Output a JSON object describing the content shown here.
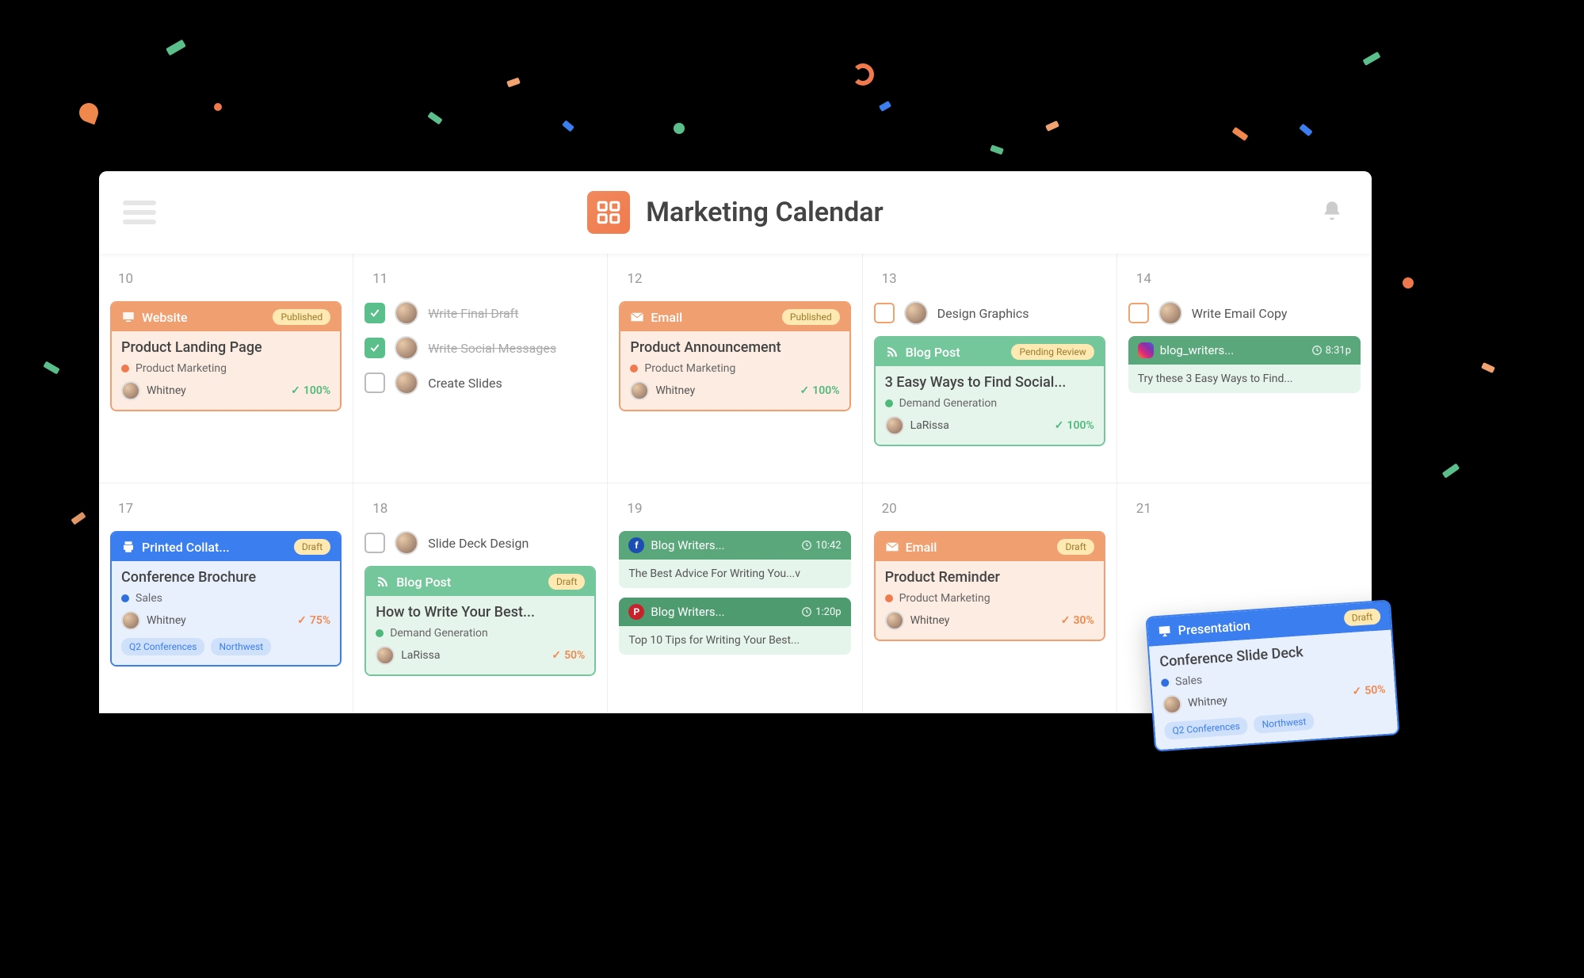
{
  "header": {
    "title": "Marketing Calendar"
  },
  "days": [
    {
      "num": "10",
      "cards": [
        {
          "variant": "orange",
          "iconType": "monitor",
          "type": "Website",
          "status": "Published",
          "title": "Product Landing Page",
          "categoryDot": "orange",
          "category": "Product Marketing",
          "assignee": "Whitney",
          "progressColor": "green",
          "progress": "100%"
        }
      ],
      "tasks": []
    },
    {
      "num": "11",
      "cards": [],
      "tasks": [
        {
          "state": "done",
          "label": "Write Final Draft",
          "strike": true
        },
        {
          "state": "done",
          "label": "Write Social Messages",
          "strike": true
        },
        {
          "state": "open",
          "label": "Create Slides",
          "strike": false
        }
      ]
    },
    {
      "num": "12",
      "cards": [
        {
          "variant": "orange",
          "iconType": "mail",
          "type": "Email",
          "status": "Published",
          "title": "Product Announcement",
          "categoryDot": "orange",
          "category": "Product Marketing",
          "assignee": "Whitney",
          "progressColor": "green",
          "progress": "100%"
        }
      ],
      "tasks": []
    },
    {
      "num": "13",
      "cards": [
        {
          "variant": "green",
          "iconType": "rss",
          "type": "Blog Post",
          "status": "Pending Review",
          "title": "3 Easy Ways to Find Social...",
          "categoryDot": "green",
          "category": "Demand Generation",
          "assignee": "LaRissa",
          "progressColor": "green",
          "progress": "100%"
        }
      ],
      "tasks": [
        {
          "state": "open-orange",
          "label": "Design Graphics",
          "strike": false
        }
      ]
    },
    {
      "num": "14",
      "social": [
        {
          "variant": "green",
          "network": "insta",
          "title": "blog_writers...",
          "time": "8:31p",
          "body": "Try these 3 Easy Ways to Find..."
        }
      ],
      "tasks": [
        {
          "state": "open-orange",
          "label": "Write Email Copy",
          "strike": false
        }
      ]
    },
    {
      "num": "17",
      "cards": [
        {
          "variant": "blue",
          "iconType": "print",
          "type": "Printed Collat...",
          "status": "Draft",
          "title": "Conference Brochure",
          "categoryDot": "blue",
          "category": "Sales",
          "assignee": "Whitney",
          "progressColor": "orange",
          "progress": "75%",
          "tags": [
            "Q2 Conferences",
            "Northwest"
          ]
        }
      ],
      "tasks": []
    },
    {
      "num": "18",
      "cards": [
        {
          "variant": "green",
          "iconType": "rss",
          "type": "Blog Post",
          "status": "Draft",
          "title": "How to Write Your Best...",
          "categoryDot": "green",
          "category": "Demand Generation",
          "assignee": "LaRissa",
          "progressColor": "orange",
          "progress": "50%"
        }
      ],
      "tasks": [
        {
          "state": "open",
          "label": "Slide Deck Design",
          "strike": false
        }
      ]
    },
    {
      "num": "19",
      "social": [
        {
          "variant": "green",
          "network": "fb",
          "title": "Blog Writers...",
          "time": "10:42",
          "body": "The Best Advice For Writing You...v"
        },
        {
          "variant": "darkgreen",
          "network": "pin",
          "title": "Blog Writers...",
          "time": "1:20p",
          "body": "Top 10 Tips for Writing Your Best..."
        }
      ],
      "tasks": []
    },
    {
      "num": "20",
      "cards": [
        {
          "variant": "orange",
          "iconType": "mail",
          "type": "Email",
          "status": "Draft",
          "title": "Product Reminder",
          "categoryDot": "orange",
          "category": "Product Marketing",
          "assignee": "Whitney",
          "progressColor": "orange",
          "progress": "30%"
        }
      ],
      "tasks": []
    },
    {
      "num": "21",
      "tasks": []
    }
  ],
  "floating": {
    "variant": "blue",
    "iconType": "present",
    "type": "Presentation",
    "status": "Draft",
    "title": "Conference Slide Deck",
    "categoryDot": "blue",
    "category": "Sales",
    "assignee": "Whitney",
    "progressColor": "orange",
    "progress": "50%",
    "tags": [
      "Q2 Conferences",
      "Northwest"
    ]
  }
}
